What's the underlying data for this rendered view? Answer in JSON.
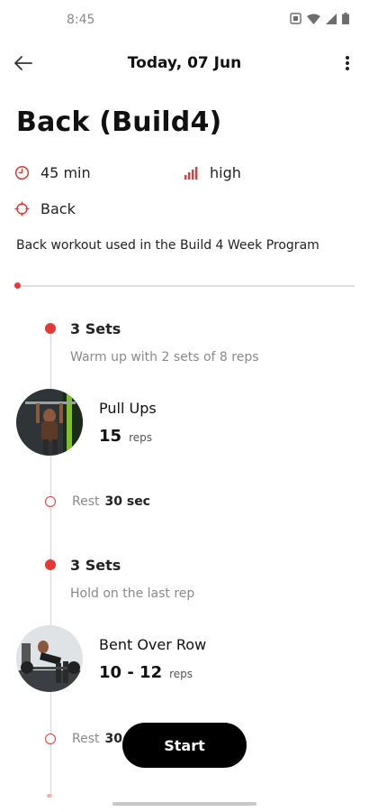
{
  "status_bar": {
    "time": "8:45"
  },
  "header": {
    "title": "Today, 07 Jun"
  },
  "workout": {
    "title": "Back (Build4)",
    "duration": "45 min",
    "intensity": "high",
    "target": "Back",
    "description": "Back workout used in the Build 4 Week Program",
    "progress": 0
  },
  "blocks": [
    {
      "sets_label": "3 Sets",
      "note": "Warm up with 2 sets of 8 reps",
      "exercise": {
        "name": "Pull Ups",
        "reps": "15",
        "reps_unit": "reps"
      },
      "rest": {
        "label": "Rest",
        "value": "30 sec"
      }
    },
    {
      "sets_label": "3 Sets",
      "note": "Hold on the last rep",
      "exercise": {
        "name": "Bent Over Row",
        "reps": "10 - 12",
        "reps_unit": "reps"
      },
      "rest": {
        "label": "Rest",
        "value": "30"
      }
    }
  ],
  "actions": {
    "start_label": "Start"
  },
  "colors": {
    "accent": "#e53935",
    "button": "#000000",
    "muted": "#8a8a8a"
  },
  "icons": {
    "back": "arrow-left-icon",
    "menu": "more-vertical-icon",
    "duration": "timer-icon",
    "intensity": "signal-bars-icon",
    "target": "crosshair-icon"
  }
}
